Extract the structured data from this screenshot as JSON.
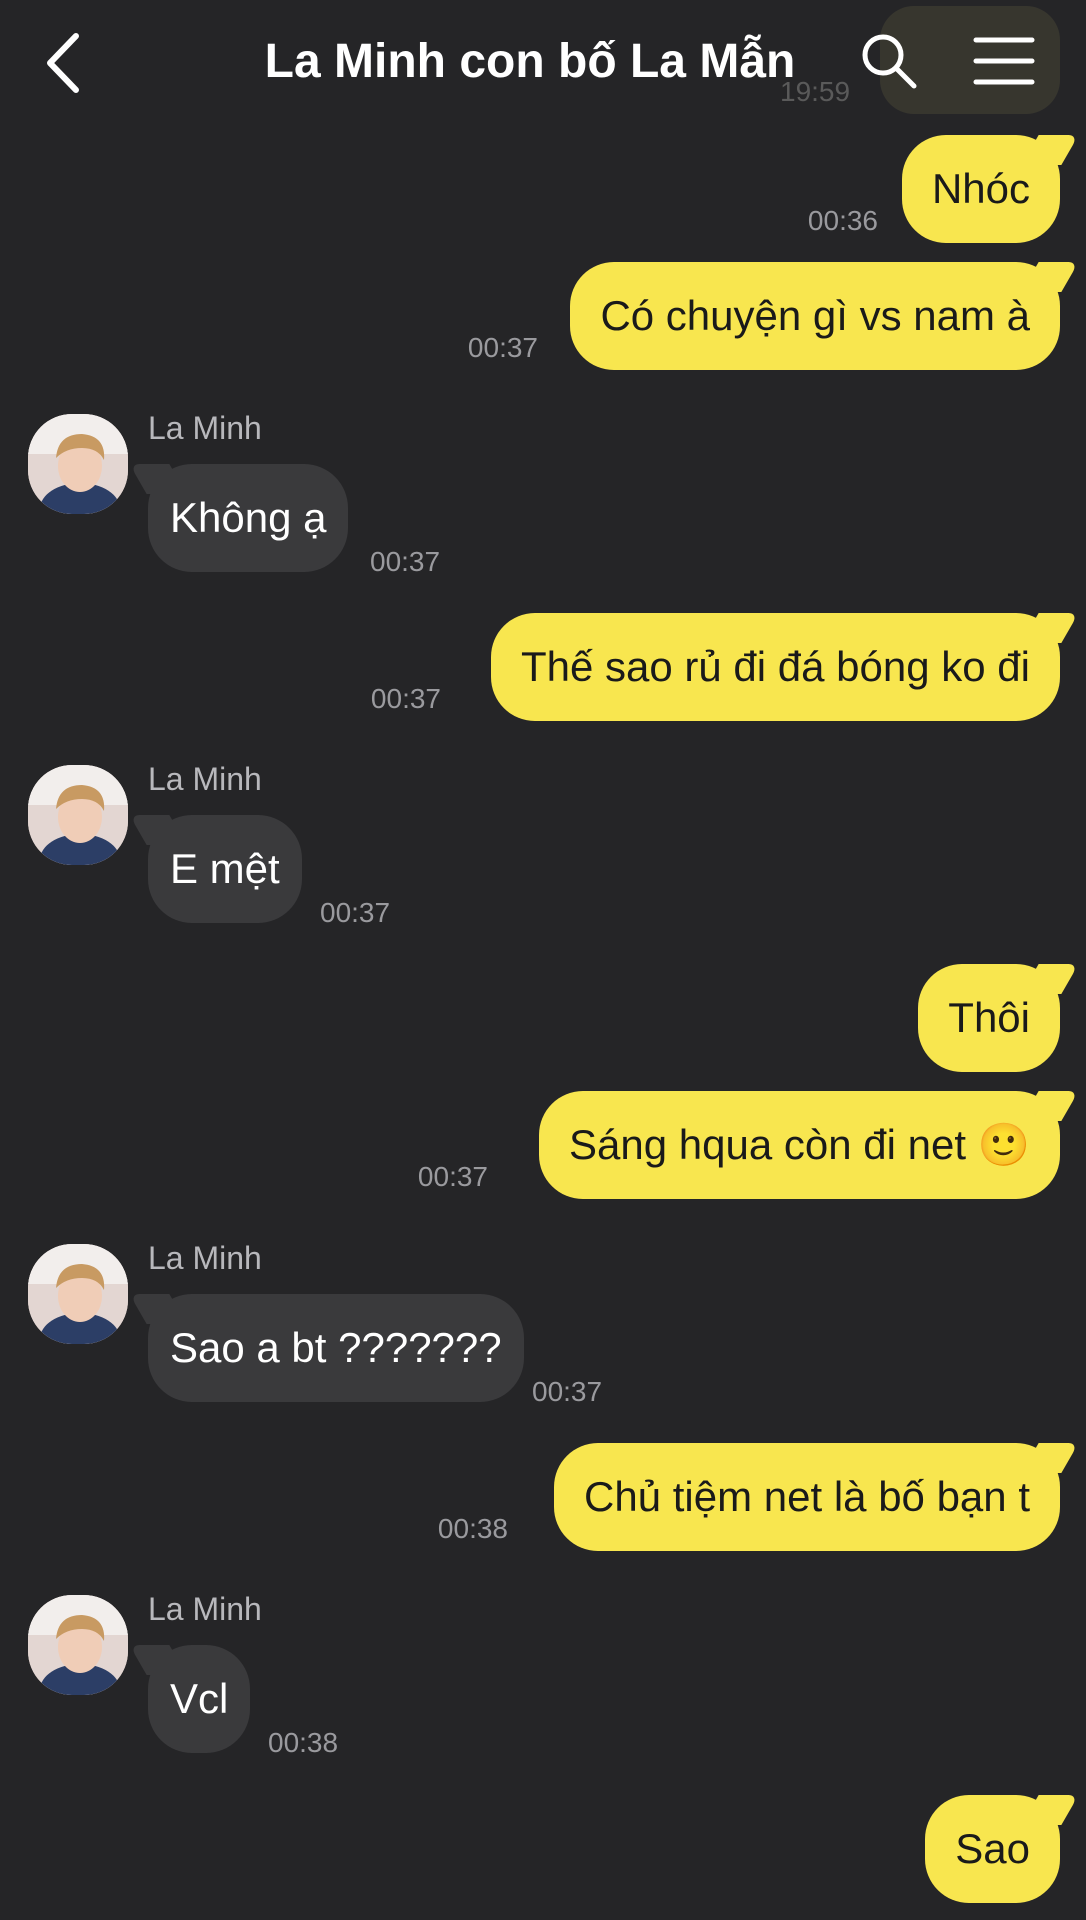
{
  "header": {
    "title": "La Minh con bố La Mẫn",
    "ghost_time": "19:59"
  },
  "colors": {
    "background": "#252527",
    "outgoing_bubble": "#f8e64f",
    "incoming_bubble": "#3a3a3c",
    "timestamp": "#9a9a9e"
  },
  "icons": {
    "back": "chevron-left-icon",
    "search": "search-icon",
    "menu": "hamburger-menu-icon"
  },
  "messages": [
    {
      "dir": "out",
      "text": "Nhóc",
      "time": "00:36"
    },
    {
      "dir": "out",
      "text": "Có chuyện gì vs nam à",
      "time": "00:37"
    },
    {
      "dir": "in",
      "sender": "La Minh",
      "text": "Không ạ",
      "time": "00:37"
    },
    {
      "dir": "out",
      "text": "Thế sao rủ đi đá bóng ko đi",
      "time": "00:37"
    },
    {
      "dir": "in",
      "sender": "La Minh",
      "text": "E mệt",
      "time": "00:37"
    },
    {
      "dir": "out",
      "text": "Thôi",
      "time": ""
    },
    {
      "dir": "out",
      "text": "Sáng hqua còn đi net 🙂",
      "time": "00:37"
    },
    {
      "dir": "in",
      "sender": "La Minh",
      "text": "Sao a bt ???????",
      "time": "00:37"
    },
    {
      "dir": "out",
      "text": "Chủ tiệm net là bố bạn t",
      "time": "00:38"
    },
    {
      "dir": "in",
      "sender": "La Minh",
      "text": "Vcl",
      "time": "00:38"
    },
    {
      "dir": "out",
      "text": "Sao",
      "time": ""
    }
  ]
}
